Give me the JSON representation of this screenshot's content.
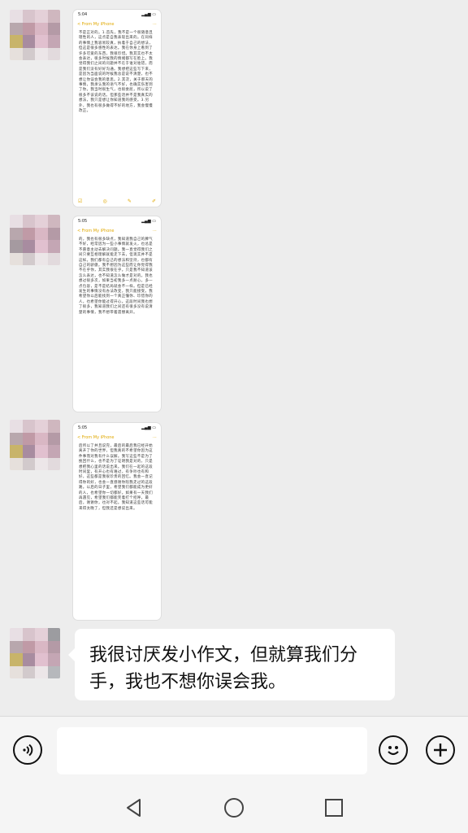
{
  "messages": [
    {
      "type": "image",
      "status_time": "5:04",
      "notes_back": "< From My iPhone",
      "text": "不是正对的。1.首先，我不是一个很随意且理性的人，这点是自我表现出来的。在同样的事情上我容易较真，执着于自己的想法，但这是很多感性的表达。我在你身上看到了许多可爱的东西，我很珍惜。我其实也不太会表达，很多时候我的情绪都写在脸上。我觉得我们之间的问题并不在于谁对谁错，而是我们没有好好沟通。我想把这些写下来，是因为当面说的时候我总是说不清楚，也不想让你误会我的意思。2.其次，关于那天的事情，我承认我的语气不好，也确实伤害到了你。我当时很生气，也很委屈，所以说了很多不该说的话。但那些话并不是我真实的想法，我只是想让你知道我的感受。3.另外，我也有很多做得不好的地方，我会慢慢改正。"
    },
    {
      "type": "image",
      "status_time": "5:05",
      "notes_back": "< From My iPhone",
      "text": "的，我也有很多缺点，我知道我自己的脾气不好，经常因为一些小事情就发火，也总是不愿意主动去解决问题。我一直觉得我们之间只要互相理解就能走下去，但现实并不是这样。我们都有自己的想法和坚持，也都有自己的骄傲。我不想因为这些而让你觉得我不在乎你，其实我很在乎。只是我不知道该怎么表达，也不知道怎么做才是对的。我也想过很多次，如果当初我多一点耐心，多一点包容，是不是结局就会不一样。但是已经发生的事情没有办法改变，我只能接受。我希望你以后能找到一个真正懂你、珍惜你的人，也希望你能过得开心。这段时间我也想了很多，我知道我们之间还有很多没有说清楚的事情，我不想带着遗憾离开。"
    },
    {
      "type": "image",
      "status_time": "5:05",
      "notes_back": "< From My iPhone",
      "text": "后所以了并且说完，最后的最后我已经开始离开了你的世界，但我真的不希望你因为这件事而对我有什么误解。我写这些不是为了挽回什么，也不是为了证明我是对的，只是想把我心里的话说出来。我们在一起的这段时间里，有开心也有难过，有争吵也有和好，这些都是我很珍贵的回忆。我会一直记得你的好，也会一直感谢你陪我走过的这段路。以后的日子里，希望我们都能成为更好的人，也希望你一切都好。如果有一天我们再遇见，希望我们都能笑着打个招呼。最后，谢谢你，也对不起。我知道这些话可能来得太晚了，但我还是想说出来。"
    },
    {
      "type": "text",
      "text": "我很讨厌发小作文，但就算我们分手，我也不想你误会我。"
    }
  ],
  "colors": {
    "chat_bg": "#ededed",
    "bubble_bg": "#ffffff",
    "notes_accent": "#e0a800"
  },
  "input_bar": {
    "left_icon": "voice-icon",
    "right_icons": [
      "emoji-icon",
      "plus-icon"
    ],
    "value": ""
  },
  "nav_bar": {
    "icons": [
      "back-icon",
      "home-icon",
      "recents-icon"
    ]
  }
}
